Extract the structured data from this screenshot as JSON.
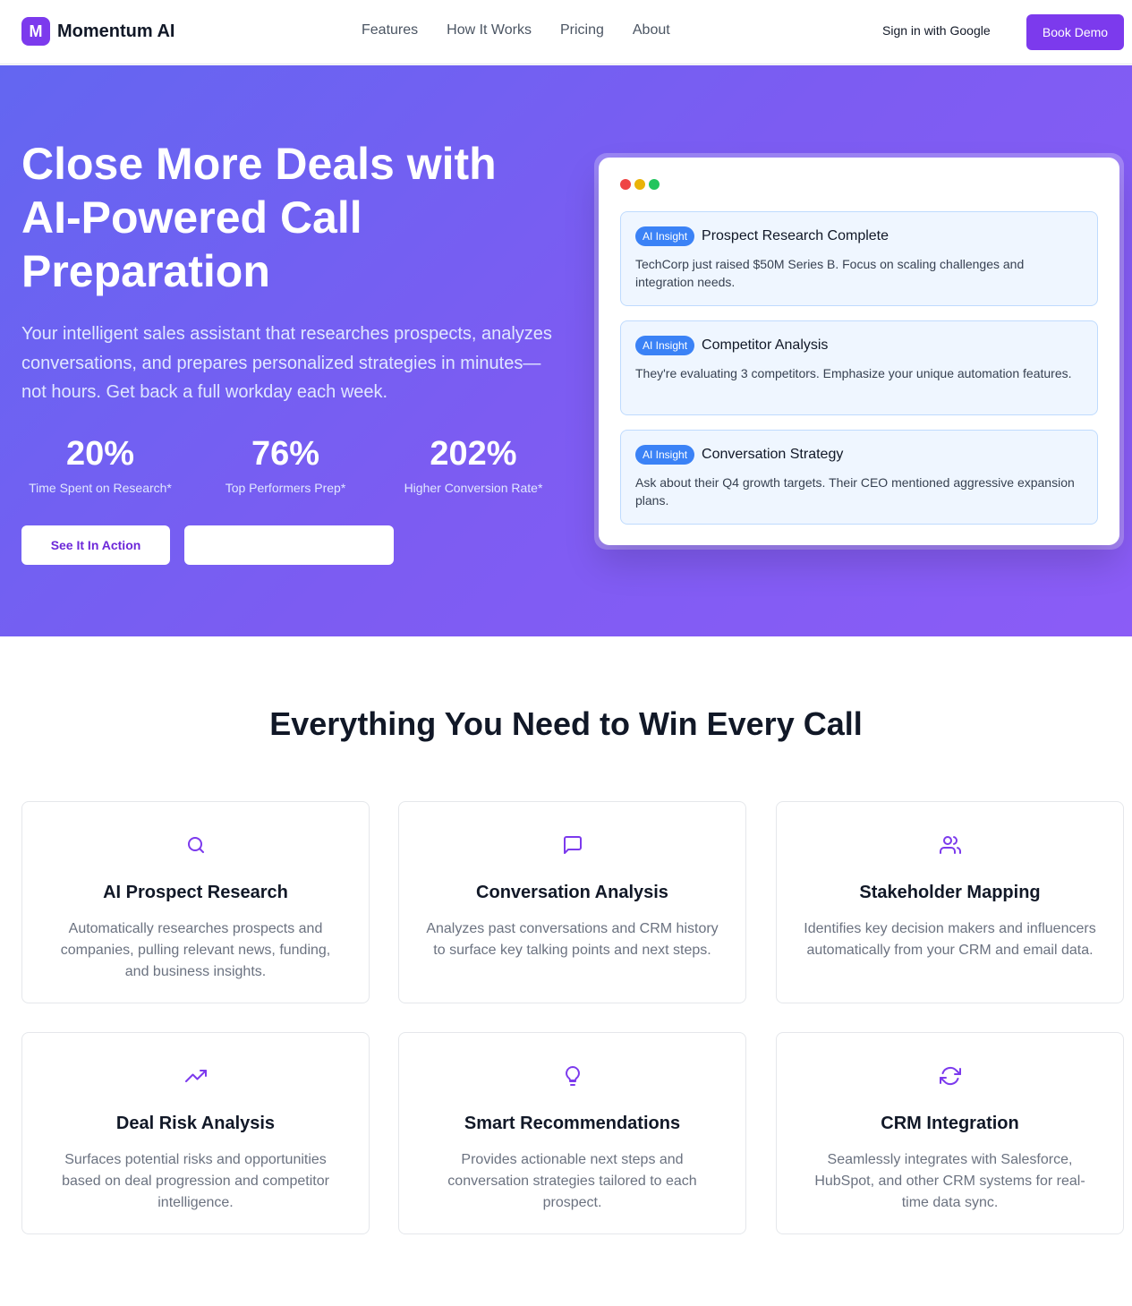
{
  "nav": {
    "logo_letter": "M",
    "brand": "Momentum AI",
    "links": [
      "Features",
      "How It Works",
      "Pricing",
      "About"
    ],
    "signin": "Sign in with Google",
    "book_demo": "Book Demo"
  },
  "hero": {
    "title": "Close More Deals with AI-Powered Call Preparation",
    "subtitle": "Your intelligent sales assistant that researches prospects, analyzes conversations, and prepares personalized strategies in minutes—not hours. Get back a full workday each week.",
    "stats": [
      {
        "value": "20%",
        "label": "Time Spent on Research*"
      },
      {
        "value": "76%",
        "label": "Top Performers Prep*"
      },
      {
        "value": "202%",
        "label": "Higher Conversion Rate*"
      }
    ],
    "cta_primary": "See It In Action",
    "cta_secondary": ""
  },
  "preview": {
    "dot_colors": [
      "#ef4444",
      "#eab308",
      "#22c55e"
    ],
    "insights": [
      {
        "badge": "AI Insight",
        "title": "Prospect Research Complete",
        "body": "TechCorp just raised $50M Series B. Focus on scaling challenges and integration needs."
      },
      {
        "badge": "AI Insight",
        "title": "Competitor Analysis",
        "body": "They're evaluating 3 competitors. Emphasize your unique automation features."
      },
      {
        "badge": "AI Insight",
        "title": "Conversation Strategy",
        "body": "Ask about their Q4 growth targets. Their CEO mentioned aggressive expansion plans."
      }
    ]
  },
  "features": {
    "title": "Everything You Need to Win Every Call",
    "cards": [
      {
        "icon": "search-icon",
        "title": "AI Prospect Research",
        "desc": "Automatically researches prospects and companies, pulling relevant news, funding, and business insights."
      },
      {
        "icon": "message-icon",
        "title": "Conversation Analysis",
        "desc": "Analyzes past conversations and CRM history to surface key talking points and next steps."
      },
      {
        "icon": "users-icon",
        "title": "Stakeholder Mapping",
        "desc": "Identifies key decision makers and influencers automatically from your CRM and email data."
      },
      {
        "icon": "trending-up-icon",
        "title": "Deal Risk Analysis",
        "desc": "Surfaces potential risks and opportunities based on deal progression and competitor intelligence."
      },
      {
        "icon": "lightbulb-icon",
        "title": "Smart Recommendations",
        "desc": "Provides actionable next steps and conversation strategies tailored to each prospect."
      },
      {
        "icon": "refresh-icon",
        "title": "CRM Integration",
        "desc": "Seamlessly integrates with Salesforce, HubSpot, and other CRM systems for real-time data sync."
      }
    ]
  },
  "colors": {
    "accent": "#7c3aed",
    "badge": "#3b82f6"
  }
}
